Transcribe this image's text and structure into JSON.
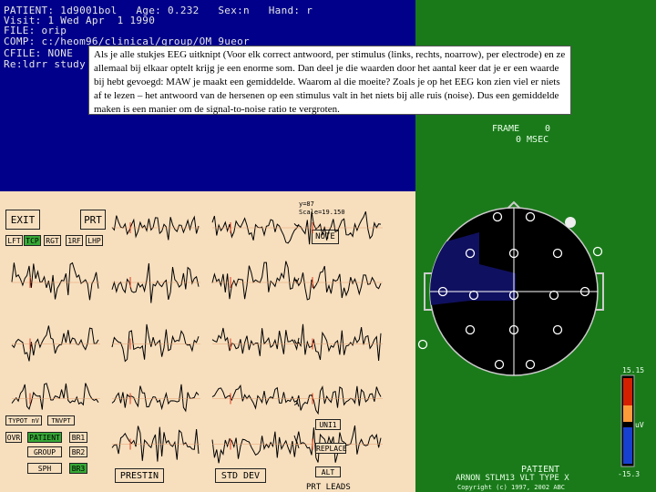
{
  "header": {
    "lines": [
      "PATIENT: 1d9001bol   Age: 0.232   Sex:n   Hand: r",
      "Visit: 1 Wed Apr  1 1990",
      "FILE: orip",
      "COMP: c:/heom96/clinical/group/OM 9ueor",
      "CFILE: NONE",
      "Re:ldrr study"
    ]
  },
  "callout": {
    "text": "Als je alle stukjes EEG uitknipt (Voor elk  correct antwoord, per stimulus (links, rechts, noarrow), per electrode) en ze allemaal bij elkaar optelt krijg je een enorme som. Dan deel je die waarden door het aantal keer dat je er een waarde bij hebt gevoegd: MAW je maakt een gemiddelde. Waarom al die moeite? Zoals je op het EEG kon zien viel er niets af te lezen – het antwoord van de hersenen op een stimulus valt in het niets bij alle ruis (noise). Dus een gemiddelde maken is een manier om de signal-to-noise ratio te vergroten."
  },
  "frame": {
    "label": "FRAME",
    "value": "0",
    "time": "0 MSEC"
  },
  "scale": {
    "line1": "y=87",
    "line2": "Scale=19.150"
  },
  "buttons": {
    "exit": "EXIT",
    "prt": "PRT",
    "note": "NOTE",
    "lft": "LFT",
    "ctr": "TCP",
    "rgt": "RGT",
    "rrf": "1RF",
    "lhp": "LHP",
    "typ1": "TYPOT nV",
    "typ2": "TNVPT",
    "ovr": "OVR",
    "patient": "PATIENT",
    "br1": "BR1",
    "group": "GROUP",
    "br2": "BR2",
    "sph": "SPH",
    "br3": "BR3",
    "uni": "UNI1",
    "replace": "REPLACE",
    "alt": "ALT",
    "prestin": "PRESTIN",
    "stddev": "STD DEV",
    "prtleads": "PRT LEADS"
  },
  "colorbar": {
    "max": "15.15",
    "min": "-15.3",
    "unit": "uV"
  },
  "footer": {
    "title": "PATIENT",
    "subtitle": "ARNON STLM13 VLT TYPE X",
    "copyright": "Copyright (c) 1997, 2002 ABC"
  },
  "colors": {
    "blue": "#00008a",
    "green": "#1a7a1a",
    "peach": "#f7dfbe",
    "marker": "#e03a1a"
  }
}
